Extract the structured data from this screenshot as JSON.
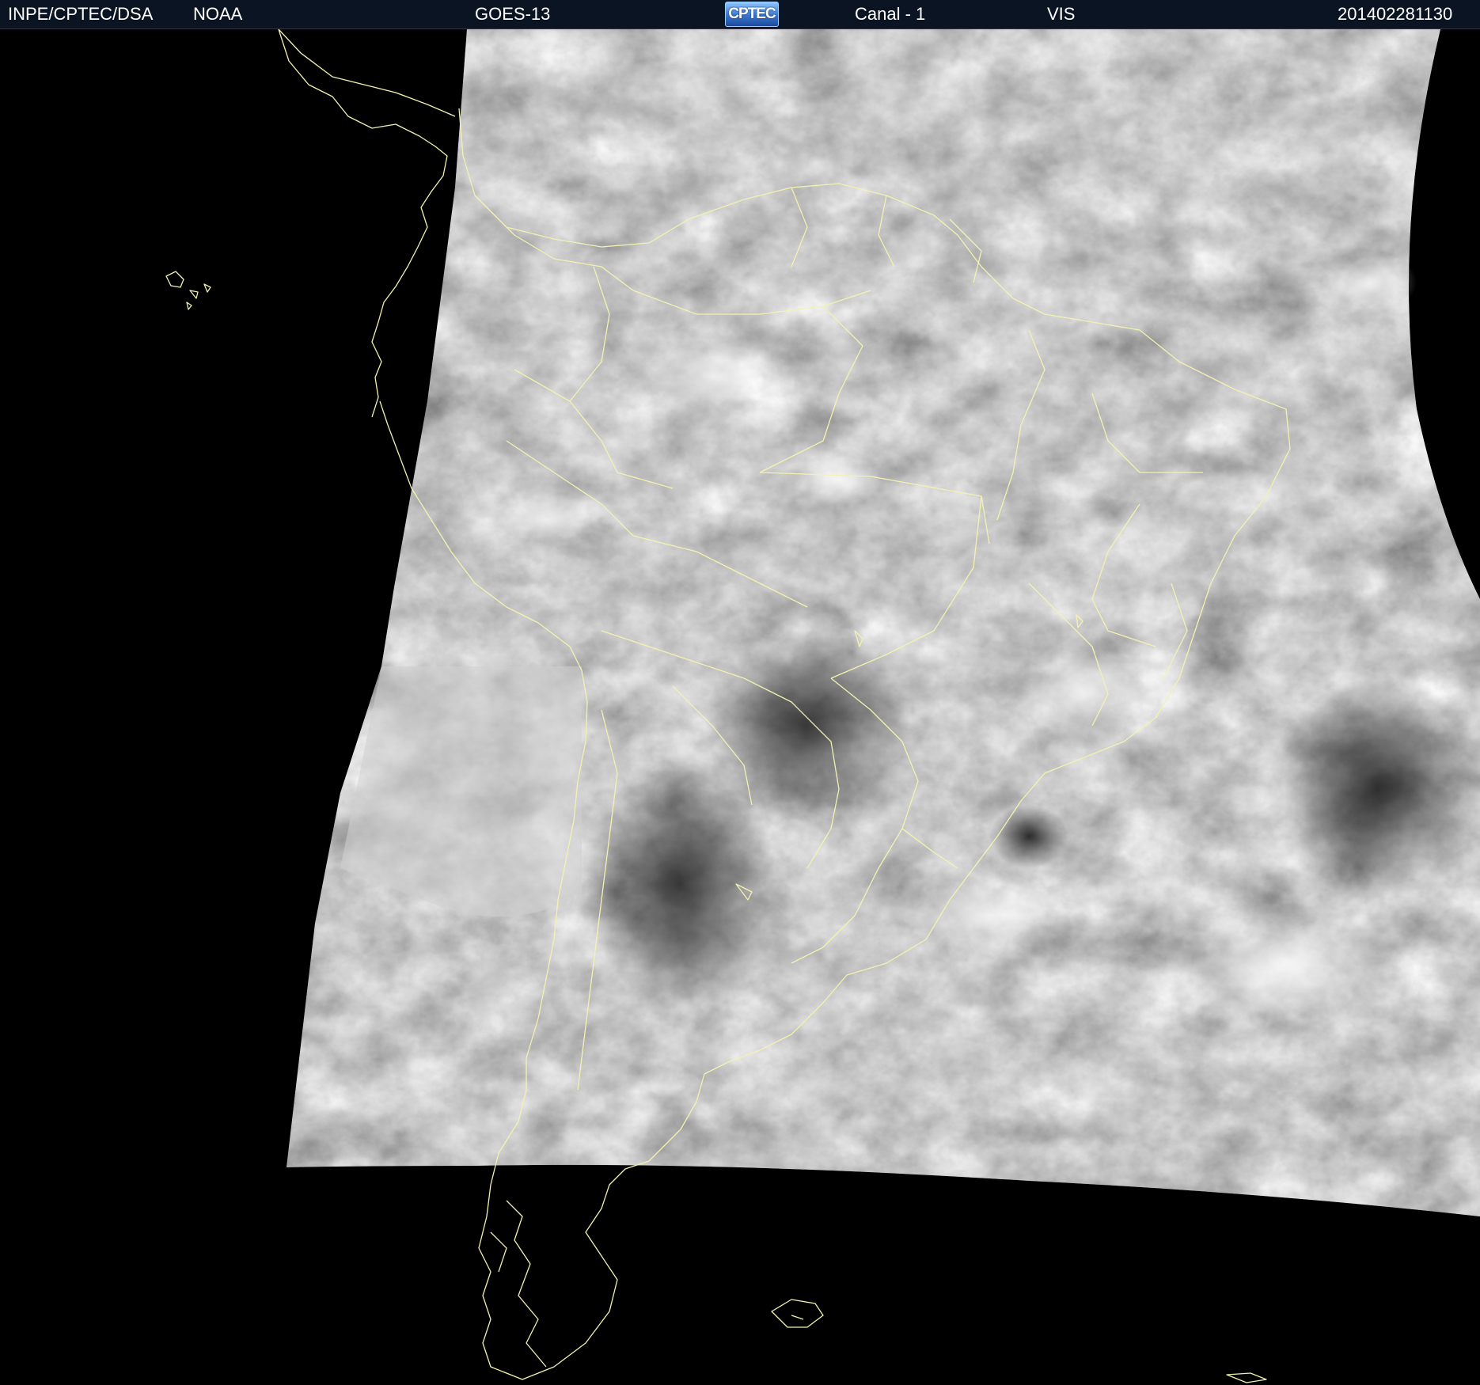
{
  "header": {
    "agency": "INPE/CPTEC/DSA",
    "source": "NOAA",
    "satellite": "GOES-13",
    "logo_text": "CPTEC",
    "channel": "Canal - 1",
    "band": "VIS",
    "timestamp": "201402281130"
  },
  "colors": {
    "background": "#000000",
    "header_background": "#0b1422",
    "header_text": "#ffffff",
    "coastline": "#f2f2b0",
    "cloud_dark": "#3a3a3a",
    "cloud_bright": "#e6e6e6"
  },
  "icons": {
    "logo": "cptec-logo"
  }
}
